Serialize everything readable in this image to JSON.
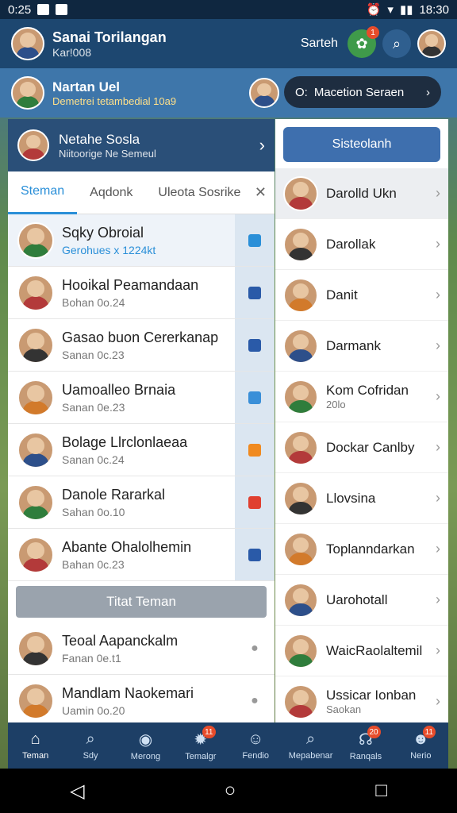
{
  "status": {
    "left_time": "0:25",
    "right_time": "18:30"
  },
  "header": {
    "name": "Sanai Torilangan",
    "sub": "Kar!008"
  },
  "header_actions": {
    "search_label": "Sarteh",
    "badge": "1"
  },
  "second": {
    "name": "Nartan Uel",
    "sub": "Demetrei tetambedial 10a9",
    "pill": "Macetion Seraen"
  },
  "left_header": {
    "name": "Netahe Sosla",
    "sub": "Niitoorige Ne Semeul"
  },
  "tabs": [
    "Steman",
    "Aqdonk",
    "Uleota Sosrike"
  ],
  "left_rows": [
    {
      "name": "Sqky Obroial",
      "sub": "Gerohues x 1224kt",
      "color": "#2a8fd8"
    },
    {
      "name": "Hooikal Peamandaan",
      "sub": "Bohan 0o.24",
      "color": "#2a5aa8"
    },
    {
      "name": "Gasao buon Cererkanap",
      "sub": "Sanan 0c.23",
      "color": "#2a5aa8"
    },
    {
      "name": "Uamoalleo Brnaia",
      "sub": "Sanan 0e.23",
      "color": "#3a8fd8"
    },
    {
      "name": "Bolage Llrclonlaeaa",
      "sub": "Sanan 0c.24",
      "color": "#f08a20"
    },
    {
      "name": "Danole Rararkal",
      "sub": "Sahan 0o.10",
      "color": "#e04030"
    },
    {
      "name": "Abante Ohalolhemin",
      "sub": "Bahan 0c.23",
      "color": "#2a5aa8"
    }
  ],
  "add_button": "Titat Teman",
  "left_rows2": [
    {
      "name": "Teoal Aapanckalm",
      "sub": "Fanan 0e.t1"
    },
    {
      "name": "Mandlam Naokemari",
      "sub": "Uamin 0o.20"
    }
  ],
  "right_button": "Sisteolanh",
  "right_rows": [
    {
      "name": "Darolld Ukn",
      "sub": ""
    },
    {
      "name": "Darollak",
      "sub": ""
    },
    {
      "name": "Danit",
      "sub": ""
    },
    {
      "name": "Darmank",
      "sub": ""
    },
    {
      "name": "Kom Cofridan",
      "sub": "20lo"
    },
    {
      "name": "Dockar Canlby",
      "sub": ""
    },
    {
      "name": "Llovsina",
      "sub": ""
    },
    {
      "name": "Toplanndarkan",
      "sub": ""
    },
    {
      "name": "Uarohotall",
      "sub": ""
    },
    {
      "name": "WaicRaolaltemil",
      "sub": ""
    },
    {
      "name": "Ussicar Ionban",
      "sub": "Saokan"
    }
  ],
  "nav": [
    {
      "label": "Teman",
      "badge": ""
    },
    {
      "label": "Sdy",
      "badge": ""
    },
    {
      "label": "Merong",
      "badge": ""
    },
    {
      "label": "Temalgr",
      "badge": "11"
    },
    {
      "label": "Fendio",
      "badge": ""
    },
    {
      "label": "Mepabenar",
      "badge": ""
    },
    {
      "label": "Ranqals",
      "badge": "20"
    },
    {
      "label": "Nerio",
      "badge": "11"
    }
  ]
}
